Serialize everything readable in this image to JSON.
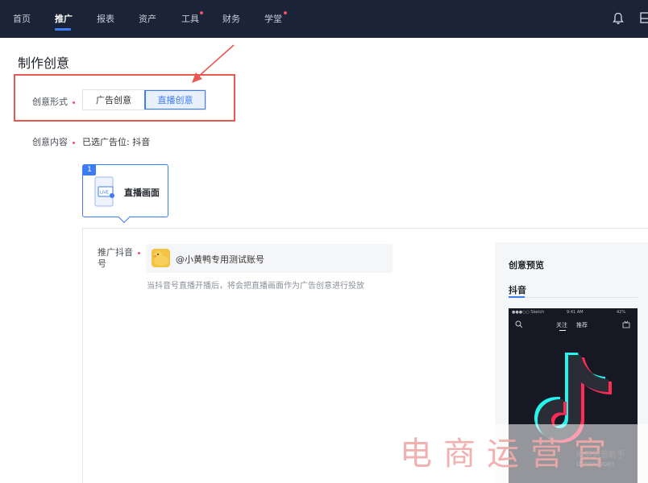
{
  "nav": {
    "items": [
      {
        "label": "首页",
        "active": false,
        "dot": false
      },
      {
        "label": "推广",
        "active": true,
        "dot": false
      },
      {
        "label": "报表",
        "active": false,
        "dot": false
      },
      {
        "label": "资产",
        "active": false,
        "dot": false
      },
      {
        "label": "工具",
        "active": false,
        "dot": true
      },
      {
        "label": "财务",
        "active": false,
        "dot": false
      },
      {
        "label": "学堂",
        "active": false,
        "dot": true
      }
    ],
    "right_icons": [
      "bell-icon",
      "panel-icon"
    ]
  },
  "page": {
    "title": "制作创意"
  },
  "form": {
    "format_label": "创意形式",
    "format_options": [
      "广告创意",
      "直播创意"
    ],
    "format_selected": "直播创意",
    "content_label": "创意内容",
    "content_value": "已选广告位:  抖音"
  },
  "card": {
    "badge": "1",
    "label": "直播画面",
    "icon": "live-screen-icon",
    "icon_text": "LIVE"
  },
  "account": {
    "label": "推广抖音号",
    "name": "@小黄鸭专用测试账号",
    "hint": "当抖音号直播开播后，将会把直播画面作为广告创意进行投放"
  },
  "preview": {
    "title": "创意预览",
    "tab": "抖音",
    "phone": {
      "status_left": "●●●○○ Sketch",
      "status_time": "9:41 AM",
      "status_right": "42%",
      "tabs": [
        "关注",
        "推荐"
      ]
    }
  },
  "watermark": {
    "big": "电商运营官",
    "small": "电商运营助手",
    "url": "dianxiaoer"
  },
  "colors": {
    "nav_bg": "#1b2336",
    "accent": "#3d7cf5",
    "annotation_red": "#e65850",
    "required_dot": "#f0506e"
  }
}
